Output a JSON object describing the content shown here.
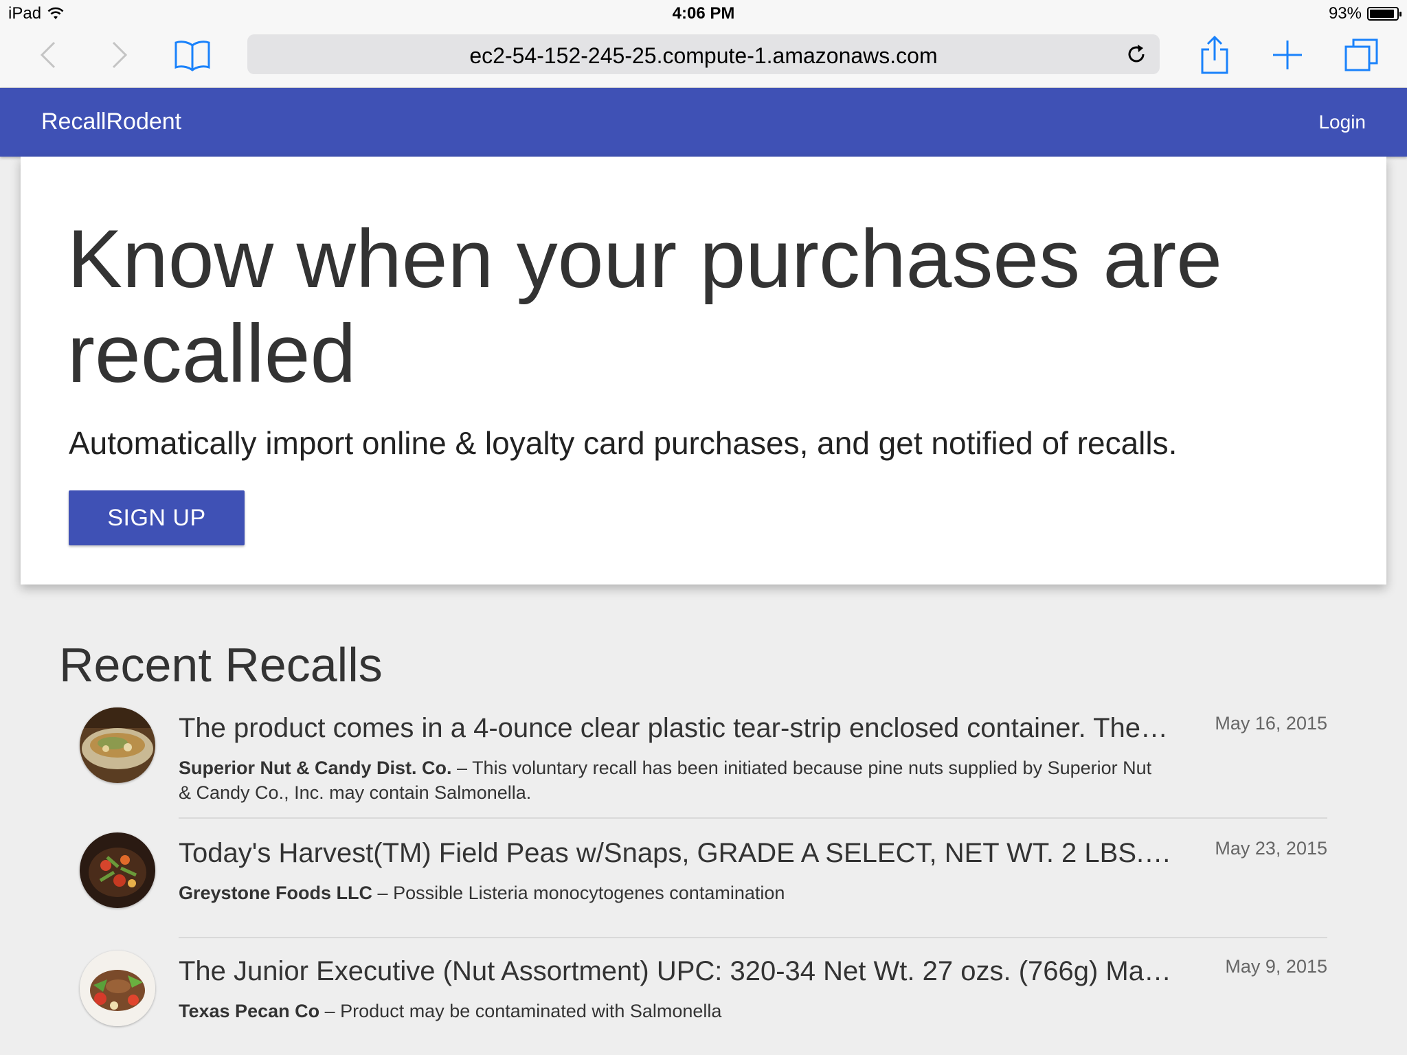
{
  "status_bar": {
    "device": "iPad",
    "time": "4:06 PM",
    "battery": "93%",
    "battery_level": 0.93
  },
  "browser": {
    "url": "ec2-54-152-245-25.compute-1.amazonaws.com"
  },
  "navbar": {
    "brand": "RecallRodent",
    "login": "Login"
  },
  "hero": {
    "title": "Know when your purchases are recalled",
    "subtitle": "Automatically import online & loyalty card purchases, and get notified of recalls.",
    "cta": "SIGN UP"
  },
  "recent": {
    "title": "Recent Recalls",
    "items": [
      {
        "title": "The product comes in a 4-ounce clear plastic tear-strip enclosed container. The …",
        "company": "Superior Nut & Candy Dist. Co.",
        "separator": " – ",
        "description": "This voluntary recall has been initiated because pine nuts supplied by Superior Nut & Candy Co., Inc. may contain Salmonella.",
        "date": "May 16, 2015"
      },
      {
        "title": "Today's Harvest(TM) Field Peas w/Snaps, GRADE A SELECT, NET WT. 2 LBS., (9…",
        "company": "Greystone Foods LLC",
        "separator": " – ",
        "description": "Possible Listeria monocytogenes contamination",
        "date": "May 23, 2015"
      },
      {
        "title": "The Junior Executive (Nut Assortment) UPC: 320-34 Net Wt. 27 ozs. (766g) Man…",
        "company": "Texas Pecan Co",
        "separator": " – ",
        "description": "Product may be contaminated with Salmonella",
        "date": "May 9, 2015"
      }
    ]
  },
  "colors": {
    "primary": "#3f51b5",
    "ios_blue": "#1a82fb",
    "background": "#eeeeee"
  }
}
